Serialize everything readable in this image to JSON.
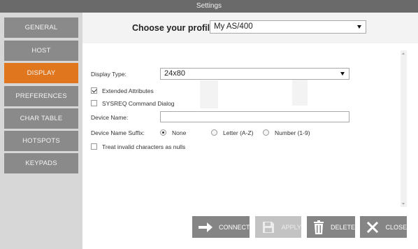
{
  "window": {
    "title": "Settings"
  },
  "sidebar": {
    "items": [
      {
        "label": "GENERAL",
        "active": false
      },
      {
        "label": "HOST",
        "active": false
      },
      {
        "label": "DISPLAY",
        "active": true
      },
      {
        "label": "PREFERENCES",
        "active": false
      },
      {
        "label": "CHAR TABLE",
        "active": false
      },
      {
        "label": "HOTSPOTS",
        "active": false
      },
      {
        "label": "KEYPADS",
        "active": false
      }
    ]
  },
  "profile": {
    "label": "Choose your profile:",
    "value": "My AS/400"
  },
  "form": {
    "display_type": {
      "label": "Display Type:",
      "value": "24x80"
    },
    "extended_attributes": {
      "label": "Extended Attributes",
      "checked": true
    },
    "sysreq_dialog": {
      "label": "SYSREQ Command Dialog",
      "checked": false
    },
    "device_name": {
      "label": "Device Name:",
      "value": ""
    },
    "device_name_suffix": {
      "label": "Device Name Suffix:",
      "options": [
        {
          "label": "None",
          "selected": true
        },
        {
          "label": "Letter (A-Z)",
          "selected": false
        },
        {
          "label": "Number (1-9)",
          "selected": false
        }
      ]
    },
    "invalid_chars_nulls": {
      "label": "Treat invalid characters as nulls",
      "checked": false
    }
  },
  "buttons": {
    "connect": {
      "label": "CONNECT",
      "enabled": true
    },
    "apply": {
      "label": "APPLY",
      "enabled": false
    },
    "delete": {
      "label": "DELETE",
      "enabled": true
    },
    "close": {
      "label": "CLOSE",
      "enabled": true
    }
  },
  "colors": {
    "accent": "#e0771e",
    "nav": "#8a8a8a",
    "button": "#858585",
    "button_disabled": "#c3c3c3",
    "titlebar": "#6a6a6a"
  }
}
